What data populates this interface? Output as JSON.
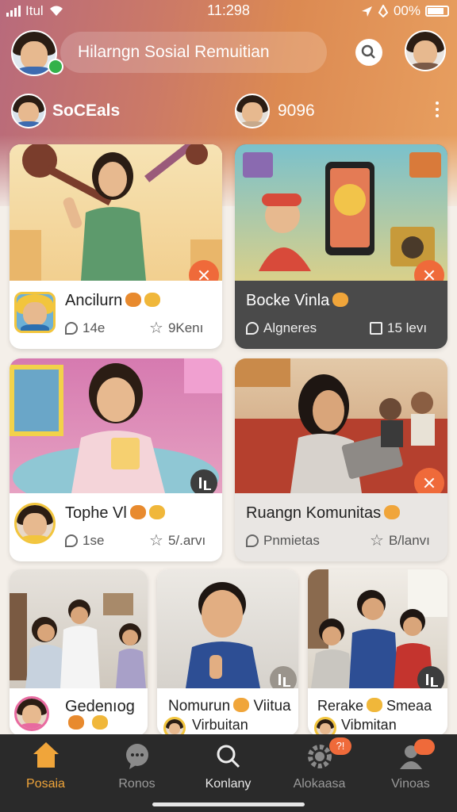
{
  "status_bar": {
    "carrier": "Itul",
    "time": "11:298",
    "battery": "00%"
  },
  "header": {
    "title": "Hilarngn Sosial Remuitian",
    "avatar_icon": "user-avatar-icon",
    "search_icon": "search-icon"
  },
  "subheader": {
    "left_label": "SoCEals",
    "right_label": "9096",
    "more_icon": "more-vertical-icon"
  },
  "cards": [
    {
      "title": "Ancilurn",
      "stat_left": "14e",
      "stat_right": "9Kenı",
      "theme": "light"
    },
    {
      "title": "Bocke Vinla",
      "stat_left": "Algneres",
      "stat_right": "15 levı",
      "theme": "dark"
    },
    {
      "title": "Tophe Vl",
      "stat_left": "1se",
      "stat_right": "5/.arvı",
      "theme": "light"
    },
    {
      "title": "Ruangn Komunitas",
      "stat_left": "Pnmietas",
      "stat_right": "B/lanvı",
      "theme": "grey"
    },
    {
      "title": "Gedenıog",
      "stat_left": "",
      "stat_right": "",
      "theme": "light"
    },
    {
      "title": "Nomurun",
      "title2": "Viitua",
      "subtitle": "Virbuitan",
      "theme": "light"
    },
    {
      "title": "Rerake",
      "title2": "Smeaa",
      "subtitle": "Vibmitan",
      "theme": "light"
    }
  ],
  "tabbar": {
    "tabs": [
      {
        "label": "Posaia",
        "icon": "home-icon",
        "active": true
      },
      {
        "label": "Ronos",
        "icon": "chat-icon",
        "active": false
      },
      {
        "label": "Konlany",
        "icon": "search-icon",
        "active": false
      },
      {
        "label": "Alokaasa",
        "icon": "gear-icon",
        "active": false,
        "badge": "?!"
      },
      {
        "label": "Vinoas",
        "icon": "profile-icon",
        "active": false
      }
    ]
  },
  "colors": {
    "accent": "#f0a53a",
    "badge": "#ef6a3a",
    "tabbar_bg": "#2a2a2a"
  }
}
